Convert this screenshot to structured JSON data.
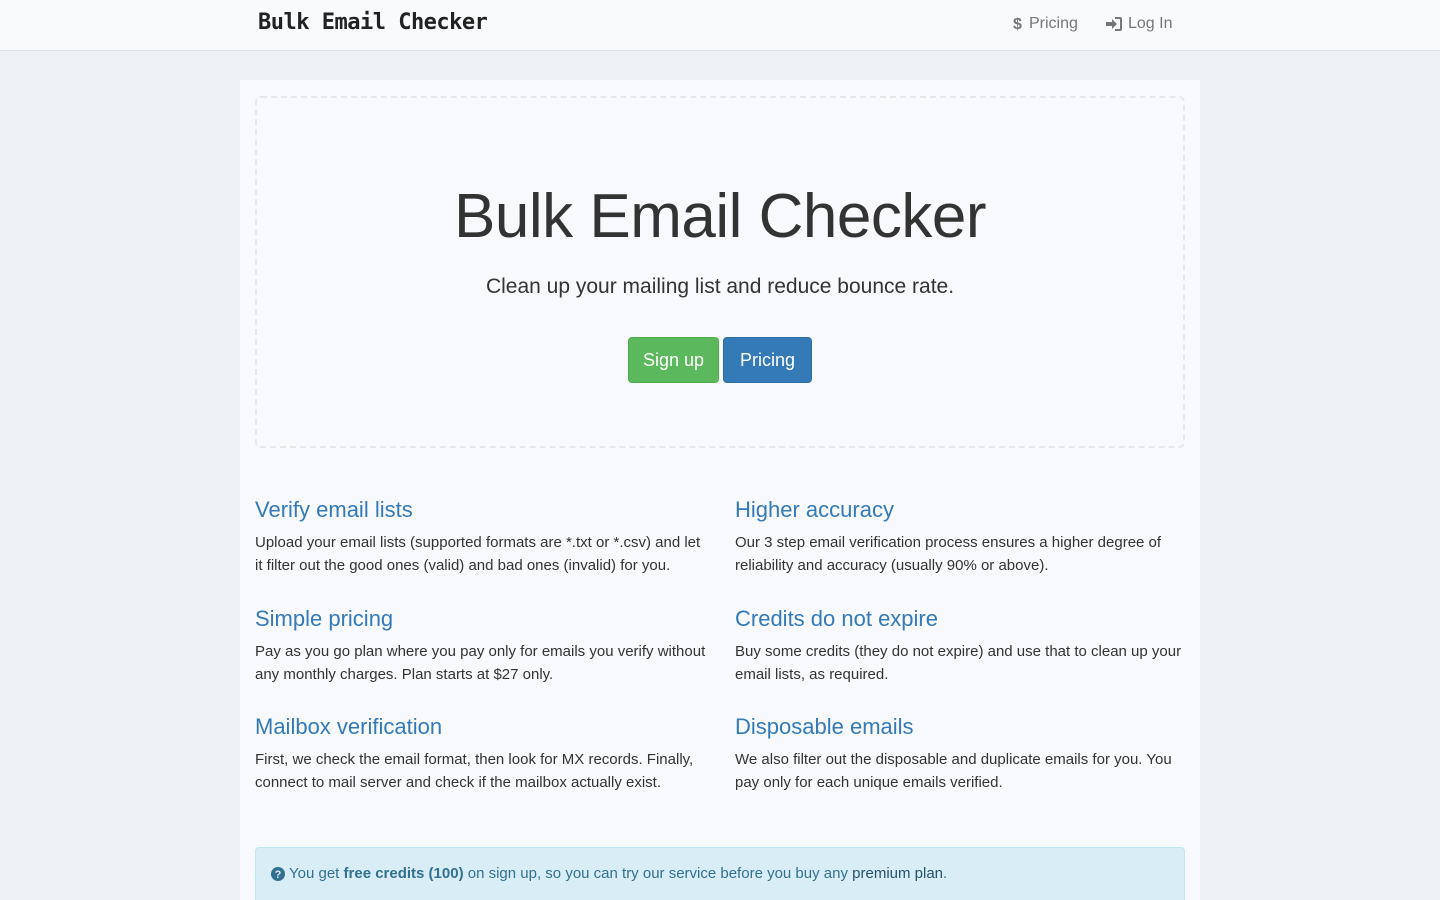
{
  "navbar": {
    "brand": "Bulk Email Checker",
    "links": [
      {
        "label": "Pricing",
        "icon": "dollar-icon"
      },
      {
        "label": "Log In",
        "icon": "sign-in-icon"
      }
    ]
  },
  "hero": {
    "title": "Bulk Email Checker",
    "subtitle": "Clean up your mailing list and reduce bounce rate.",
    "signup_label": "Sign up",
    "pricing_label": "Pricing"
  },
  "features": [
    {
      "title": "Verify email lists",
      "text": "Upload your email lists (supported formats are *.txt or *.csv) and let it filter out the good ones (valid) and bad ones (invalid) for you."
    },
    {
      "title": "Higher accuracy",
      "text": "Our 3 step email verification process ensures a higher degree of reliability and accuracy (usually 90% or above)."
    },
    {
      "title": "Simple pricing",
      "text": "Pay as you go plan where you pay only for emails you verify without any monthly charges. Plan starts at $27 only."
    },
    {
      "title": "Credits do not expire",
      "text": "Buy some credits (they do not expire) and use that to clean up your email lists, as required."
    },
    {
      "title": "Mailbox verification",
      "text": "First, we check the email format, then look for MX records. Finally, connect to mail server and check if the mailbox actually exist."
    },
    {
      "title": "Disposable emails",
      "text": "We also filter out the disposable and duplicate emails for you. You pay only for each unique emails verified."
    }
  ],
  "alert": {
    "icon": "question-circle-icon",
    "prefix": "You get",
    "bold": "free credits (100)",
    "middle": "on sign up, so you can try our service before you buy any",
    "link": "premium plan",
    "suffix": "."
  },
  "colors": {
    "link": "#337ab7",
    "success": "#5cb85c",
    "primary": "#337ab7",
    "info_bg": "#d9edf7",
    "info_text": "#31708f"
  }
}
